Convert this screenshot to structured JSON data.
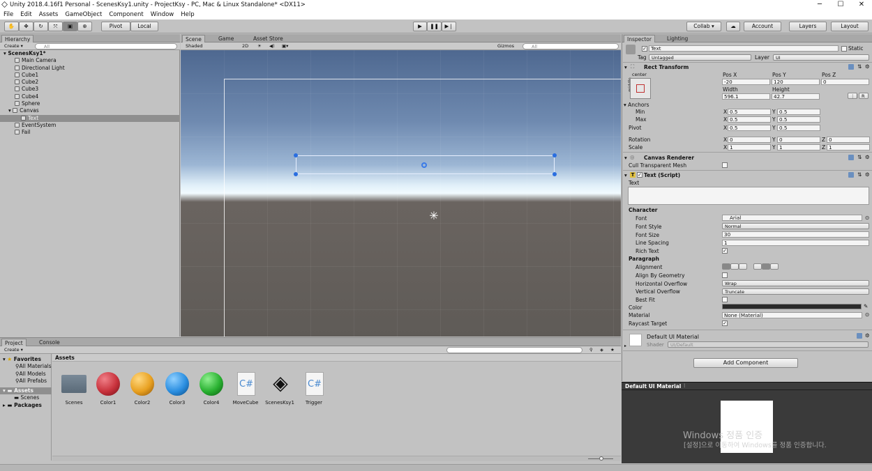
{
  "titlebar": {
    "title": "Unity 2018.4.16f1 Personal - ScenesKsy1.unity - ProjectKsy - PC, Mac & Linux Standalone* <DX11>",
    "minimize": "─",
    "maximize": "☐",
    "close": "✕"
  },
  "menu": [
    "File",
    "Edit",
    "Assets",
    "GameObject",
    "Component",
    "Window",
    "Help"
  ],
  "toolbar": {
    "pivot": "Pivot",
    "local": "Local",
    "collab": "Collab ▾",
    "account": "Account",
    "layers": "Layers",
    "layout": "Layout"
  },
  "hierarchy": {
    "tab": "Hierarchy",
    "create": "Create ▾",
    "search_placeholder": "All",
    "scene": "ScenesKsy1*",
    "items": [
      "Main Camera",
      "Directional Light",
      "Cube1",
      "Cube2",
      "Cube3",
      "Cube4",
      "Sphere",
      "Canvas",
      "Text",
      "EventSystem",
      "Fail"
    ]
  },
  "scene": {
    "tabs": [
      "Scene",
      "Game",
      "Asset Store"
    ],
    "shading": "Shaded",
    "mode2d": "2D",
    "gizmos": "Gizmos",
    "search_placeholder": "All"
  },
  "project": {
    "tabs": [
      "Project",
      "Console"
    ],
    "create": "Create ▾",
    "breadcrumb": "Assets",
    "tree": {
      "favorites": "Favorites",
      "fav_items": [
        "All Materials",
        "All Models",
        "All Prefabs"
      ],
      "assets": "Assets",
      "asset_items": [
        "Scenes"
      ],
      "packages": "Packages"
    },
    "assets": [
      {
        "name": "Scenes",
        "kind": "folder"
      },
      {
        "name": "Color1",
        "kind": "sphere",
        "color": "#c8323c"
      },
      {
        "name": "Color2",
        "kind": "sphere",
        "color": "#e8a020"
      },
      {
        "name": "Color3",
        "kind": "sphere",
        "color": "#2a8ee0"
      },
      {
        "name": "Color4",
        "kind": "sphere",
        "color": "#28b030"
      },
      {
        "name": "MoveCube",
        "kind": "script"
      },
      {
        "name": "ScenesKsy1",
        "kind": "unity"
      },
      {
        "name": "Trigger",
        "kind": "script"
      }
    ]
  },
  "inspector": {
    "tabs": [
      "Inspector",
      "Lighting"
    ],
    "name": "Text",
    "static": "Static",
    "tag_label": "Tag",
    "tag": "Untagged",
    "layer_label": "Layer",
    "layer": "UI",
    "rect": {
      "title": "Rect Transform",
      "anchor_h": "center",
      "anchor_v": "middle",
      "posx_label": "Pos X",
      "posy_label": "Pos Y",
      "posz_label": "Pos Z",
      "posx": "-20",
      "posy": "120",
      "posz": "0",
      "width_label": "Width",
      "height_label": "Height",
      "width": "596.1",
      "height": "42.7",
      "r_btn": "R",
      "anchors": "Anchors",
      "min": "Min",
      "max": "Max",
      "pivot": "Pivot",
      "x": "X",
      "y": "Y",
      "z": "Z",
      "min_x": "0.5",
      "min_y": "0.5",
      "max_x": "0.5",
      "max_y": "0.5",
      "pivot_x": "0.5",
      "pivot_y": "0.5",
      "rotation": "Rotation",
      "rot_x": "0",
      "rot_y": "0",
      "rot_z": "0",
      "scale": "Scale",
      "sc_x": "1",
      "sc_y": "1",
      "sc_z": "1"
    },
    "canvas_renderer": {
      "title": "Canvas Renderer",
      "cull": "Cull Transparent Mesh"
    },
    "text_script": {
      "title": "Text (Script)",
      "text_label": "Text",
      "character": "Character",
      "font_label": "Font",
      "font": "Arial",
      "font_style_label": "Font Style",
      "font_style": "Normal",
      "font_size_label": "Font Size",
      "font_size": "30",
      "line_spacing_label": "Line Spacing",
      "line_spacing": "1",
      "rich_text_label": "Rich Text",
      "paragraph": "Paragraph",
      "alignment_label": "Alignment",
      "align_geo_label": "Align By Geometry",
      "h_overflow_label": "Horizontal Overflow",
      "h_overflow": "Wrap",
      "v_overflow_label": "Vertical Overflow",
      "v_overflow": "Truncate",
      "best_fit_label": "Best Fit",
      "color_label": "Color",
      "color": "#2a2a2a",
      "material_label": "Material",
      "material": "None (Material)",
      "raycast_label": "Raycast Target"
    },
    "material": {
      "name": "Default UI Material",
      "shader_label": "Shader",
      "shader": "UI/Default"
    },
    "add_component": "Add Component",
    "preview_title": "Default UI Material"
  },
  "watermark": {
    "line1": "Windows 정품 인증",
    "line2": "[설정]으로 이동하여 Windows를 정품 인증합니다."
  }
}
